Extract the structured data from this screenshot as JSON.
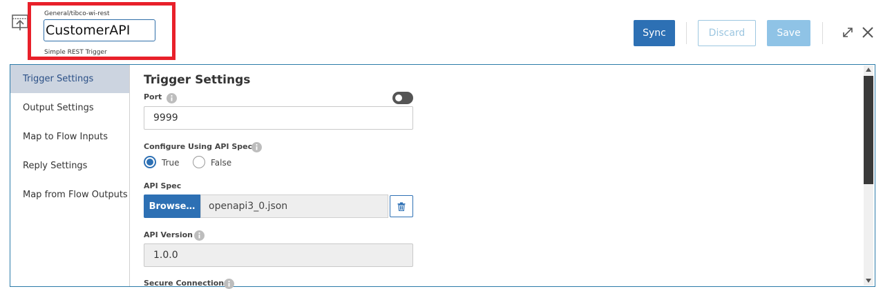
{
  "header": {
    "path": "General/tibco-wi-rest",
    "name": "CustomerAPI",
    "subtitle": "Simple REST Trigger",
    "sync_label": "Sync",
    "discard_label": "Discard",
    "save_label": "Save"
  },
  "sidebar": {
    "items": [
      {
        "label": "Trigger Settings",
        "active": true
      },
      {
        "label": "Output Settings"
      },
      {
        "label": "Map to Flow Inputs"
      },
      {
        "label": "Reply Settings"
      },
      {
        "label": "Map from Flow Outputs"
      }
    ]
  },
  "main": {
    "title": "Trigger Settings",
    "port": {
      "label": "Port",
      "value": "9999"
    },
    "api_specs": {
      "label": "Configure Using API Specs",
      "true_label": "True",
      "false_label": "False",
      "selected": "True"
    },
    "api_spec": {
      "label": "API Spec",
      "browse_label": "Browse…",
      "file": "openapi3_0.json"
    },
    "api_version": {
      "label": "API Version",
      "value": "1.0.0"
    },
    "secure": {
      "label": "Secure Connection"
    }
  },
  "colors": {
    "accent": "#2d70b4",
    "highlight": "#e8202a",
    "sidebar_active_bg": "#ccd4e0",
    "panel_border": "#2a7aa8"
  },
  "icons": {
    "trigger": "rest-trigger-icon",
    "expand": "expand-icon",
    "close": "close-icon",
    "info": "info-icon",
    "delete": "trash-icon"
  }
}
